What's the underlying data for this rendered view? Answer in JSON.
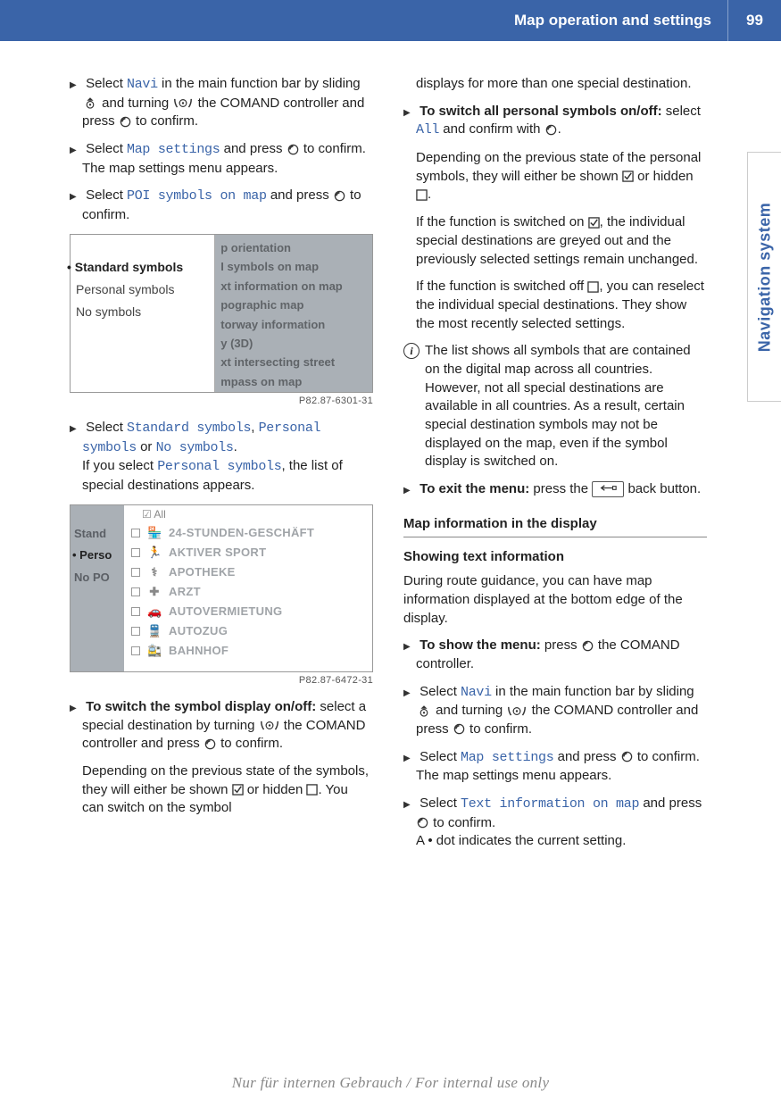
{
  "header": {
    "title": "Map operation and settings",
    "page": "99"
  },
  "sideTab": "Navigation system",
  "col1": {
    "p1a": "Select ",
    "p1_navi": "Navi",
    "p1b": " in the main function bar by sliding ",
    "p1c": " and turning ",
    "p1d": " the COMAND controller and press ",
    "p1e": " to confirm.",
    "p2a": "Select ",
    "p2_ms": "Map settings",
    "p2b": " and press ",
    "p2c": " to confirm.",
    "p2d": "The map settings menu appears.",
    "p3a": "Select ",
    "p3_poi": "POI symbols on map",
    "p3b": " and press ",
    "p3c": " to confirm.",
    "ss1_left": [
      "Standard symbols",
      "Personal symbols",
      "No symbols"
    ],
    "ss1_right": [
      "p orientation",
      "I symbols on map",
      "xt information on map",
      "pographic map",
      "torway information",
      "y (3D)",
      "xt intersecting street",
      "mpass on map"
    ],
    "ss1_cap": "P82.87-6301-31",
    "p4a": "Select ",
    "p4_s1": "Standard symbols",
    "p4_c1": ", ",
    "p4_s2": "Personal symbols",
    "p4_c2": " or ",
    "p4_s3": "No symbols",
    "p4_c3": ".",
    "p4b_a": "If you select ",
    "p4b_s": "Personal symbols",
    "p4b_b": ", the list of special destinations appears.",
    "ss2_left": [
      "Stand",
      "Perso",
      "No PO"
    ],
    "ss2_hdr": "☑ All",
    "ss2_rows": [
      {
        "ic": "🏪",
        "t": "24-STUNDEN-GESCHÄFT"
      },
      {
        "ic": "🏃",
        "t": "AKTIVER SPORT"
      },
      {
        "ic": "⚕",
        "t": "APOTHEKE"
      },
      {
        "ic": "✚",
        "t": "ARZT"
      },
      {
        "ic": "🚗",
        "t": "AUTOVERMIETUNG"
      },
      {
        "ic": "🚆",
        "t": "AUTOZUG"
      },
      {
        "ic": "🚉",
        "t": "BAHNHOF"
      }
    ],
    "ss2_cap": "P82.87-6472-31",
    "p5_bold": "To switch the symbol display on/off:",
    "p5a": " select a special destination by turning ",
    "p5b": " the COMAND controller and press ",
    "p5c": " to confirm.",
    "p5d_a": "Depending on the previous state of the symbols, they will either be shown ",
    "p5d_b": " or hidden ",
    "p5d_c": ". You can switch on the symbol "
  },
  "col2": {
    "p0": "displays for more than one special destination.",
    "p1_bold": "To switch all personal symbols on/off:",
    "p1a": " select ",
    "p1_all": "All",
    "p1b": " and confirm with ",
    "p1c": ".",
    "p1d_a": "Depending on the previous state of the personal symbols, they will either be shown ",
    "p1d_b": " or hidden ",
    "p1d_c": ".",
    "p1e_a": "If the function is switched on ",
    "p1e_b": ", the individual special destinations are greyed out and the previously selected settings remain unchanged.",
    "p1f_a": "If the function is switched off ",
    "p1f_b": ", you can reselect the individual special destinations. They show the most recently selected settings.",
    "info": "The list shows all symbols that are contained on the digital map across all countries. However, not all special destinations are available in all countries. As a result, certain special destination symbols may not be displayed on the map, even if the symbol display is switched on.",
    "p2_bold": "To exit the menu:",
    "p2a": " press the ",
    "p2b": " back button.",
    "section": "Map information in the display",
    "sub": "Showing text information",
    "p3": "During route guidance, you can have map information displayed at the bottom edge of the display.",
    "p4_bold": "To show the menu:",
    "p4a": " press ",
    "p4b": " the COMAND controller.",
    "p5a": "Select ",
    "p5_navi": "Navi",
    "p5b": " in the main function bar by sliding ",
    "p5c": " and turning ",
    "p5d": " the COMAND controller and press ",
    "p5e": " to confirm.",
    "p6a": "Select ",
    "p6_ms": "Map settings",
    "p6b": " and press ",
    "p6c": " to confirm.",
    "p6d": "The map settings menu appears.",
    "p7a": "Select ",
    "p7_ti": "Text information on map",
    "p7b": " and press ",
    "p7c": " to confirm.",
    "p7d": "A  •  dot indicates the current setting."
  },
  "footer": "Nur für internen Gebrauch / For internal use only"
}
